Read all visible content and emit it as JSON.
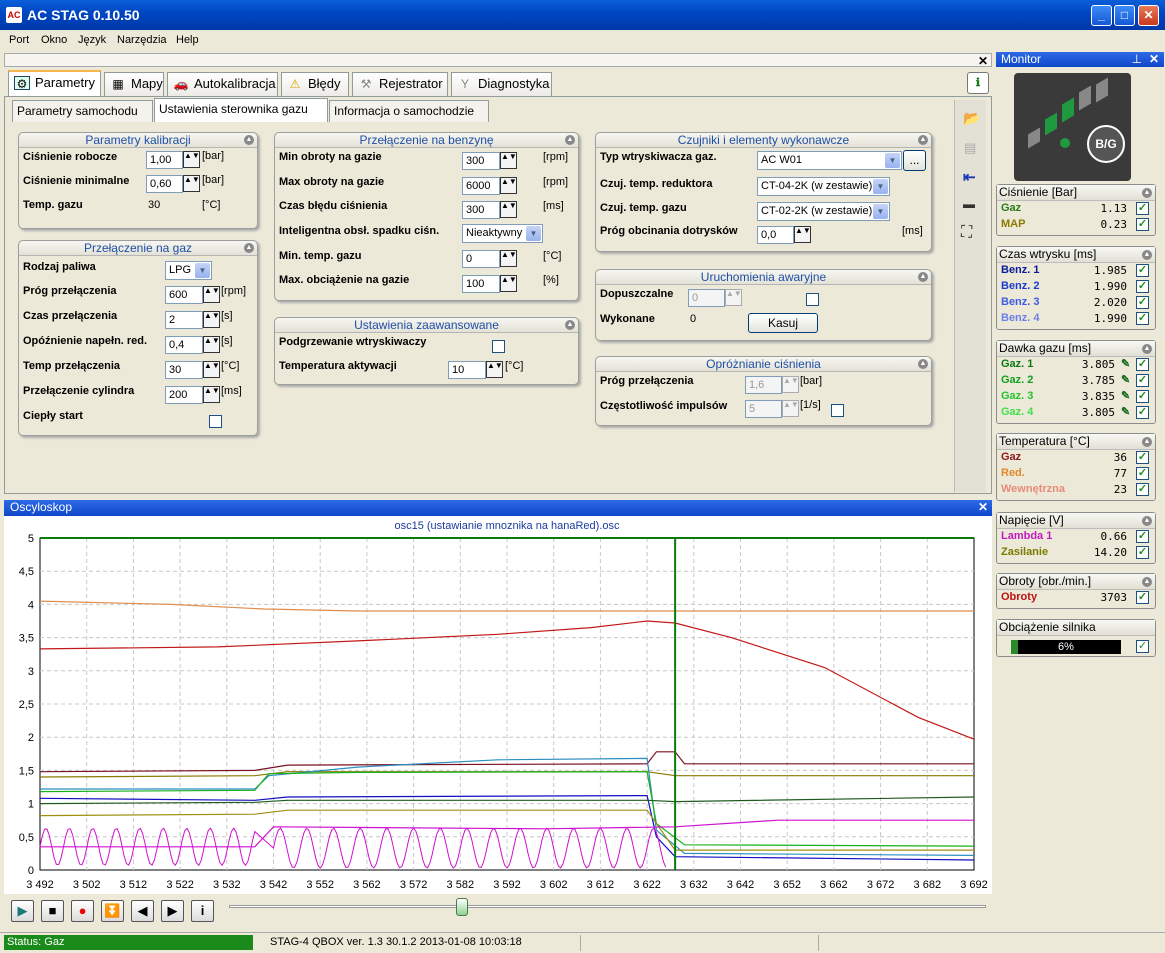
{
  "window": {
    "title": "AC STAG 0.10.50",
    "app_icon_label": "AC"
  },
  "menu": [
    "Port",
    "Okno",
    "Język",
    "Narzędzia",
    "Help"
  ],
  "main_tabs": [
    {
      "label": "Parametry",
      "icon": "settings-icon"
    },
    {
      "label": "Mapy",
      "icon": "grid-icon"
    },
    {
      "label": "Autokalibracja",
      "icon": "car-icon"
    },
    {
      "label": "Błędy",
      "icon": "warning-icon"
    },
    {
      "label": "Rejestrator",
      "icon": "recorder-icon"
    },
    {
      "label": "Diagnostyka",
      "icon": "diagnostics-icon"
    }
  ],
  "sub_tabs": [
    "Parametry samochodu",
    "Ustawienia sterownika gazu",
    "Informacja o samochodzie"
  ],
  "groups": {
    "kalibracja": {
      "title": "Parametry kalibracji",
      "rows": [
        {
          "label": "Ciśnienie robocze",
          "value": "1,00",
          "unit": "[bar]"
        },
        {
          "label": "Ciśnienie minimalne",
          "value": "0,60",
          "unit": "[bar]"
        },
        {
          "label": "Temp. gazu",
          "value": "30",
          "unit": "[°C]"
        }
      ]
    },
    "gaz": {
      "title": "Przełączenie na gaz",
      "fuel_label": "Rodzaj paliwa",
      "fuel_value": "LPG",
      "rows": [
        {
          "label": "Próg przełączenia",
          "value": "600",
          "unit": "[rpm]"
        },
        {
          "label": "Czas przełączenia",
          "value": "2",
          "unit": "[s]"
        },
        {
          "label": "Opóźnienie napełn. red.",
          "value": "0,4",
          "unit": "[s]"
        },
        {
          "label": "Temp przełączenia",
          "value": "30",
          "unit": "[°C]"
        },
        {
          "label": "Przełączenie cylindra",
          "value": "200",
          "unit": "[ms]"
        }
      ],
      "warm_label": "Ciepły start"
    },
    "benzyna": {
      "title": "Przełączenie na benzynę",
      "rows": [
        {
          "label": "Min obroty na gazie",
          "value": "300",
          "unit": "[rpm]"
        },
        {
          "label": "Max obroty na gazie",
          "value": "6000",
          "unit": "[rpm]"
        },
        {
          "label": "Czas błędu ciśnienia",
          "value": "300",
          "unit": "[ms]"
        }
      ],
      "intel_label": "Inteligentna obsł. spadku ciśn.",
      "intel_value": "Nieaktywny",
      "rows2": [
        {
          "label": "Min. temp. gazu",
          "value": "0",
          "unit": "[°C]"
        },
        {
          "label": "Max. obciążenie na gazie",
          "value": "100",
          "unit": "[%]"
        }
      ]
    },
    "zaawansowane": {
      "title": "Ustawienia zaawansowane",
      "heat_label": "Podgrzewanie wtryskiwaczy",
      "act_label": "Temperatura aktywacji",
      "act_value": "10",
      "act_unit": "[°C]"
    },
    "czujniki": {
      "title": "Czujniki i elementy wykonawcze",
      "inj_label": "Typ wtryskiwacza gaz.",
      "inj_value": "AC W01",
      "more_label": "...",
      "red_label": "Czuj. temp. reduktora",
      "red_value": "CT-04-2K (w zestawie)",
      "gas_label": "Czuj. temp. gazu",
      "gas_value": "CT-02-2K (w zestawie)",
      "cut_label": "Próg obcinania dotrysków",
      "cut_value": "0,0",
      "cut_unit": "[ms]"
    },
    "awaryjne": {
      "title": "Uruchomienia awaryjne",
      "allowed_label": "Dopuszczalne",
      "allowed_value": "0",
      "done_label": "Wykonane",
      "done_value": "0",
      "reset_label": "Kasuj"
    },
    "oproznianie": {
      "title": "Opróżnianie ciśnienia",
      "thr_label": "Próg przełączenia",
      "thr_value": "1,6",
      "thr_unit": "[bar]",
      "freq_label": "Częstotliwość impulsów",
      "freq_value": "5",
      "freq_unit": "[1/s]"
    }
  },
  "monitor": {
    "title": "Monitor",
    "indicator_label": "B/G",
    "pressure": {
      "title": "Ciśnienie [Bar]",
      "rows": [
        {
          "name": "Gaz",
          "value": "1.13",
          "color": "#2b7a1b"
        },
        {
          "name": "MAP",
          "value": "0.23",
          "color": "#8a7a00"
        }
      ]
    },
    "inj_time": {
      "title": "Czas wtrysku [ms]",
      "rows": [
        {
          "name": "Benz. 1",
          "value": "1.985",
          "color": "#0a1a9e"
        },
        {
          "name": "Benz. 2",
          "value": "1.990",
          "color": "#1b3bd0"
        },
        {
          "name": "Benz. 3",
          "value": "2.020",
          "color": "#3e5ae8"
        },
        {
          "name": "Benz. 4",
          "value": "1.990",
          "color": "#6d7fe8"
        }
      ]
    },
    "dose": {
      "title": "Dawka gazu [ms]",
      "rows": [
        {
          "name": "Gaz. 1",
          "value": "3.805",
          "color": "#0a7a12"
        },
        {
          "name": "Gaz. 2",
          "value": "3.785",
          "color": "#14a01e"
        },
        {
          "name": "Gaz. 3",
          "value": "3.835",
          "color": "#22c42e"
        },
        {
          "name": "Gaz. 4",
          "value": "3.805",
          "color": "#3ee04a"
        }
      ]
    },
    "temp": {
      "title": "Temperatura [°C]",
      "rows": [
        {
          "name": "Gaz",
          "value": "36",
          "color": "#8b1a1a"
        },
        {
          "name": "Red.",
          "value": "77",
          "color": "#e0882a"
        },
        {
          "name": "Wewnętrzna",
          "value": "23",
          "color": "#e88a7a"
        }
      ]
    },
    "voltage": {
      "title": "Napięcie [V]",
      "rows": [
        {
          "name": "Lambda 1",
          "value": "0.66",
          "color": "#c01ac0"
        },
        {
          "name": "Zasilanie",
          "value": "14.20",
          "color": "#7a7a00"
        }
      ]
    },
    "rpm": {
      "title": "Obroty [obr./min.]",
      "rows": [
        {
          "name": "Obroty",
          "value": "3703",
          "color": "#c01010"
        }
      ]
    },
    "load": {
      "title": "Obciążenie silnika",
      "value": "6%",
      "fraction": 0.06
    }
  },
  "oscilloscope": {
    "title": "Oscyloskop"
  },
  "status": {
    "state": "Status: Gaz",
    "device": "STAG-4 QBOX  ver. 1.3  30.1.2  2013-01-08 10:03:18"
  },
  "chart_data": {
    "type": "line",
    "title": "osc15 (ustawianie mnoznika na hanaRed).osc",
    "xlim": [
      3492,
      3692
    ],
    "ylim": [
      0,
      5
    ],
    "xticks": [
      "3 492",
      "3 502",
      "3 512",
      "3 522",
      "3 532",
      "3 542",
      "3 552",
      "3 562",
      "3 572",
      "3 582",
      "3 592",
      "3 602",
      "3 612",
      "3 622",
      "3 632",
      "3 642",
      "3 652",
      "3 662",
      "3 672",
      "3 682",
      "3 692"
    ],
    "yticks": [
      "0",
      "0,5",
      "1",
      "1,5",
      "2",
      "2,5",
      "3",
      "3,5",
      "4",
      "4,5",
      "5"
    ],
    "cursor_x": 3628,
    "grid": true,
    "series": [
      {
        "color": "#e08c4a",
        "points": [
          [
            3492,
            4.05
          ],
          [
            3520,
            4.0
          ],
          [
            3540,
            3.93
          ],
          [
            3560,
            3.9
          ],
          [
            3600,
            3.9
          ],
          [
            3628,
            3.9
          ],
          [
            3692,
            3.9
          ]
        ]
      },
      {
        "color": "#c21818",
        "points": [
          [
            3492,
            3.33
          ],
          [
            3530,
            3.36
          ],
          [
            3560,
            3.45
          ],
          [
            3590,
            3.55
          ],
          [
            3610,
            3.65
          ],
          [
            3622,
            3.75
          ],
          [
            3628,
            3.72
          ],
          [
            3640,
            3.5
          ],
          [
            3660,
            3.05
          ],
          [
            3680,
            2.3
          ],
          [
            3692,
            1.97
          ]
        ]
      },
      {
        "color": "#7a1020",
        "points": [
          [
            3492,
            1.48
          ],
          [
            3538,
            1.5
          ],
          [
            3545,
            1.58
          ],
          [
            3622,
            1.6
          ],
          [
            3624,
            1.78
          ],
          [
            3628,
            1.78
          ],
          [
            3630,
            1.6
          ],
          [
            3692,
            1.6
          ]
        ]
      },
      {
        "color": "#8a7a00",
        "points": [
          [
            3492,
            1.4
          ],
          [
            3538,
            1.42
          ],
          [
            3545,
            1.48
          ],
          [
            3622,
            1.48
          ],
          [
            3628,
            1.42
          ],
          [
            3692,
            1.42
          ]
        ]
      },
      {
        "color": "#2a8ec0",
        "points": [
          [
            3492,
            1.22
          ],
          [
            3538,
            1.22
          ],
          [
            3541,
            1.42
          ],
          [
            3560,
            1.55
          ],
          [
            3590,
            1.66
          ],
          [
            3622,
            1.68
          ],
          [
            3624,
            0.6
          ],
          [
            3630,
            0.25
          ],
          [
            3692,
            0.22
          ]
        ]
      },
      {
        "color": "#18b018",
        "points": [
          [
            3492,
            1.18
          ],
          [
            3538,
            1.2
          ],
          [
            3541,
            1.45
          ],
          [
            3560,
            1.47
          ],
          [
            3622,
            1.48
          ],
          [
            3624,
            0.7
          ],
          [
            3630,
            0.38
          ],
          [
            3692,
            0.36
          ]
        ]
      },
      {
        "color": "#1010c0",
        "points": [
          [
            3492,
            1.08
          ],
          [
            3538,
            1.05
          ],
          [
            3545,
            1.1
          ],
          [
            3622,
            1.12
          ],
          [
            3624,
            0.5
          ],
          [
            3628,
            0.2
          ],
          [
            3692,
            0.15
          ]
        ]
      },
      {
        "color": "#205a20",
        "points": [
          [
            3492,
            1.0
          ],
          [
            3538,
            1.02
          ],
          [
            3545,
            1.05
          ],
          [
            3622,
            1.05
          ],
          [
            3628,
            1.03
          ],
          [
            3692,
            1.1
          ]
        ]
      },
      {
        "color": "#a09010",
        "points": [
          [
            3492,
            0.82
          ],
          [
            3538,
            0.84
          ],
          [
            3545,
            0.9
          ],
          [
            3622,
            0.9
          ],
          [
            3628,
            0.3
          ],
          [
            3692,
            0.3
          ]
        ]
      },
      {
        "color": "#d010d0",
        "points": [
          [
            3492,
            0.35
          ],
          [
            3538,
            0.35
          ],
          [
            3542,
            0.65
          ],
          [
            3600,
            0.62
          ],
          [
            3628,
            0.65
          ],
          [
            3650,
            0.75
          ],
          [
            3692,
            0.75
          ]
        ]
      }
    ]
  }
}
